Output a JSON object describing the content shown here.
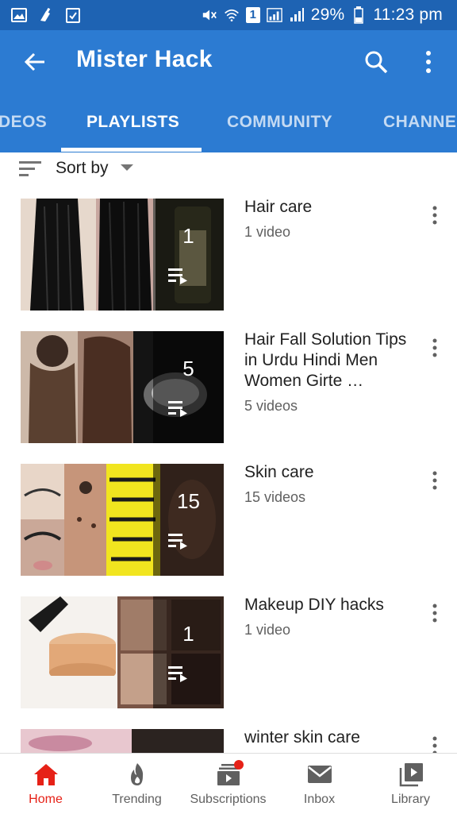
{
  "status_bar": {
    "battery": "29%",
    "time": "11:23 pm",
    "sim": "1"
  },
  "app_bar": {
    "title": "Mister Hack",
    "icons": [
      "back-arrow-icon",
      "search-icon",
      "more-vert-icon"
    ]
  },
  "tabs": [
    {
      "label": "VIDEOS",
      "visible_text": "DEOS"
    },
    {
      "label": "PLAYLISTS",
      "active": true
    },
    {
      "label": "COMMUNITY"
    },
    {
      "label": "CHANNELS",
      "visible_text": "CHANNEL"
    }
  ],
  "sort": {
    "label": "Sort by"
  },
  "playlists": [
    {
      "title": "Hair care",
      "count": "1",
      "subtitle": "1 video"
    },
    {
      "title": "Hair Fall Solution Tips in Urdu Hindi Men Women Girte …",
      "count": "5",
      "subtitle": "5 videos"
    },
    {
      "title": "Skin care",
      "count": "15",
      "subtitle": "15 videos"
    },
    {
      "title": "Makeup DIY hacks",
      "count": "1",
      "subtitle": "1 video"
    },
    {
      "title": "winter skin care",
      "count": "",
      "subtitle": ""
    }
  ],
  "bottom_nav": [
    {
      "label": "Home",
      "icon": "home-icon",
      "active": true
    },
    {
      "label": "Trending",
      "icon": "flame-icon"
    },
    {
      "label": "Subscriptions",
      "icon": "subscriptions-icon",
      "badge": true
    },
    {
      "label": "Inbox",
      "icon": "mail-icon"
    },
    {
      "label": "Library",
      "icon": "library-icon"
    }
  ],
  "colors": {
    "status_bar": "#1e63b3",
    "app_bar": "#2c7bd2",
    "active_nav": "#e62117"
  }
}
